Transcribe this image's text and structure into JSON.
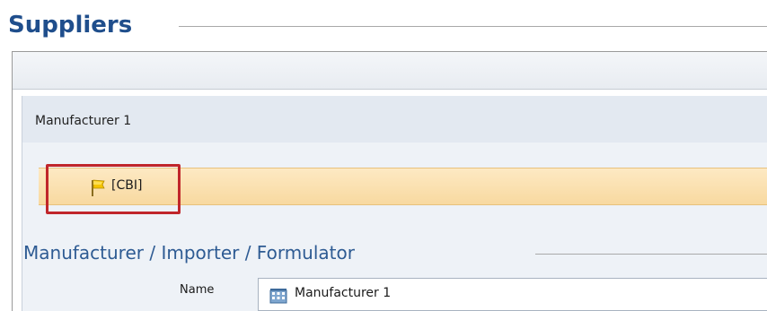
{
  "section": {
    "title": "Suppliers"
  },
  "supplier_panel": {
    "title": "Manufacturer 1",
    "cbi_tag": "[CBI]"
  },
  "subsection": {
    "title": "Manufacturer / Importer / Formulator"
  },
  "name_field": {
    "label": "Name",
    "value": "Manufacturer 1"
  },
  "icons": {
    "flag": "flag-icon",
    "building": "building-icon"
  },
  "colors": {
    "title_blue": "#1f4e8c",
    "cbi_bar": "#fbe2b3",
    "highlight_red": "#c0262b"
  }
}
